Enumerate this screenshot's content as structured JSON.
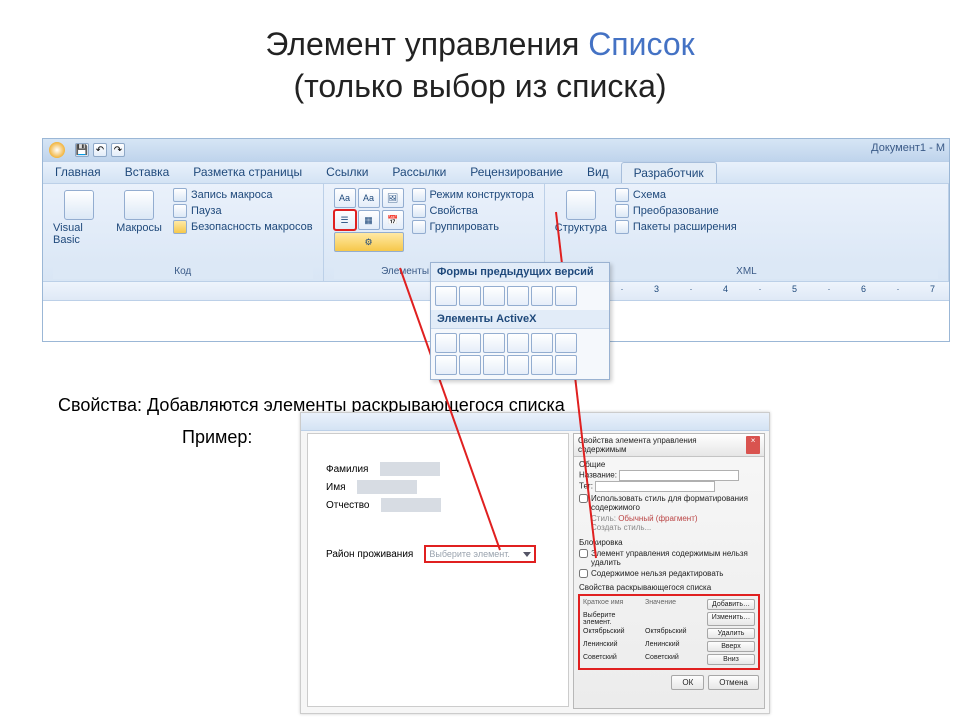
{
  "title_plain": "Элемент управления ",
  "title_hl": "Список",
  "subtitle": "(только выбор из списка)",
  "titlebar": {
    "doc_name": "Документ1 - M"
  },
  "tabs": {
    "home": "Главная",
    "insert": "Вставка",
    "layout": "Разметка страницы",
    "refs": "Ссылки",
    "mail": "Рассылки",
    "review": "Рецензирование",
    "view": "Вид",
    "dev": "Разработчик"
  },
  "code": {
    "vb": "Visual Basic",
    "macros": "Макросы",
    "rec": "Запись макроса",
    "pause": "Пауза",
    "sec": "Безопасность макросов",
    "group": "Код"
  },
  "controls": {
    "design": "Режим конструктора",
    "props": "Свойства",
    "group": "Группировать",
    "label": "Элементы управления"
  },
  "xml": {
    "structure": "Структура",
    "schema": "Схема",
    "transform": "Преобразование",
    "packs": "Пакеты расширения",
    "group": "XML"
  },
  "dropdown": {
    "hdr1": "Формы предыдущих версий",
    "hdr2": "Элементы ActiveX"
  },
  "ruler_tail": "1 · 2 · 3 · 4 · 5 · 6 · 7",
  "prop_text": "Свойства: Добавляются  элементы раскрывающегося списка",
  "example_label": "Пример:",
  "form": {
    "last": "Фамилия",
    "first": "Имя",
    "patr": "Отчество",
    "district": "Район проживания",
    "combo_placeholder": "Выберите элемент."
  },
  "dlg": {
    "title": "Свойства элемента управления содержимым",
    "general": "Общие",
    "label_name": "Название:",
    "label_tag": "Тег:",
    "use_style": "Использовать стиль для форматирования содержимого",
    "style_label": "Стиль:",
    "style_value": "Обычный (фрагмент)",
    "new_style": "Создать стиль...",
    "lock": "Блокировка",
    "lock1": "Элемент управления содержимым нельзя удалить",
    "lock2": "Содержимое нельзя редактировать",
    "list_hdr": "Свойства раскрывающегося списка",
    "col1": "Краткое имя",
    "col2": "Значение",
    "rows": [
      "Выберите элемент.",
      "Октябрьский",
      "Ленинский",
      "Советский"
    ],
    "btn_add": "Добавить…",
    "btn_edit": "Изменить…",
    "btn_del": "Удалить",
    "btn_up": "Вверх",
    "btn_down": "Вниз",
    "ok": "ОК",
    "cancel": "Отмена"
  }
}
